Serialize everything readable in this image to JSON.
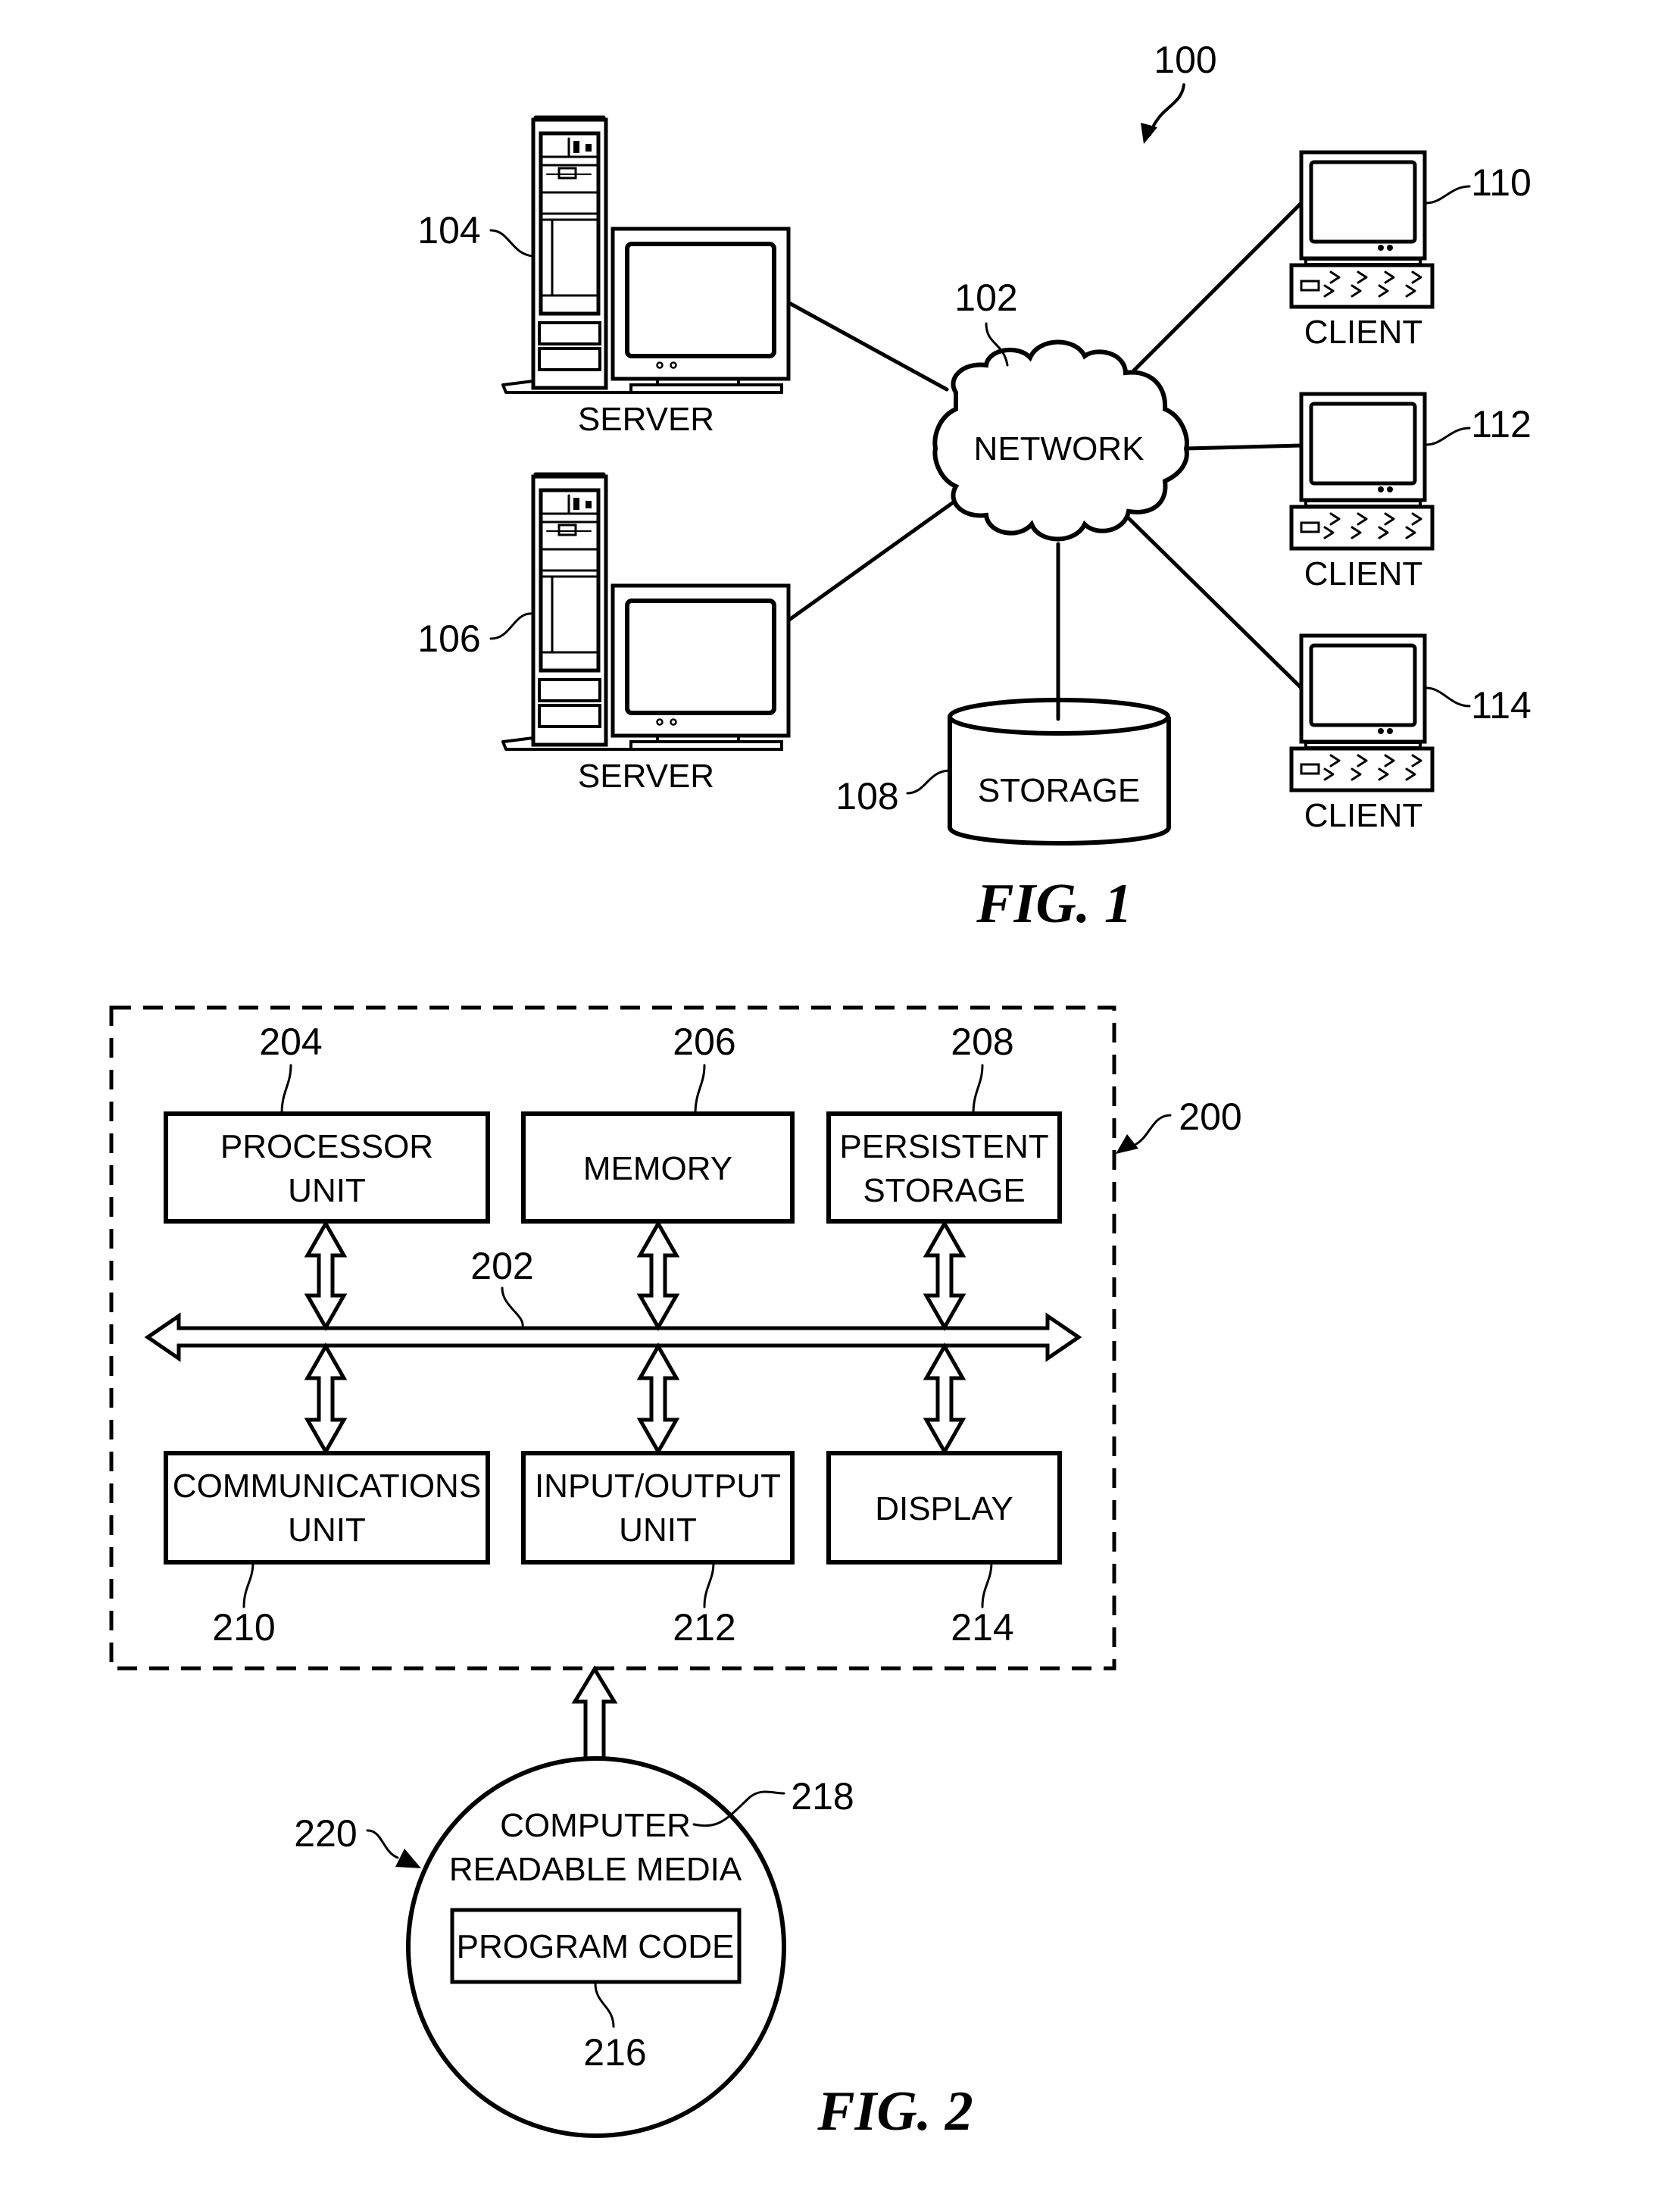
{
  "figure1": {
    "caption": "FIG. 1",
    "system_ref": "100",
    "network": {
      "label": "NETWORK",
      "ref": "102"
    },
    "servers": [
      {
        "label": "SERVER",
        "ref": "104"
      },
      {
        "label": "SERVER",
        "ref": "106"
      }
    ],
    "storage": {
      "label": "STORAGE",
      "ref": "108"
    },
    "clients": [
      {
        "label": "CLIENT",
        "ref": "110"
      },
      {
        "label": "CLIENT",
        "ref": "112"
      },
      {
        "label": "CLIENT",
        "ref": "114"
      }
    ]
  },
  "figure2": {
    "caption": "FIG. 2",
    "system_ref": "200",
    "bus_ref": "202",
    "top_row": [
      {
        "line1": "PROCESSOR",
        "line2": "UNIT",
        "ref": "204"
      },
      {
        "line1": "MEMORY",
        "line2": "",
        "ref": "206"
      },
      {
        "line1": "PERSISTENT",
        "line2": "STORAGE",
        "ref": "208"
      }
    ],
    "bottom_row": [
      {
        "line1": "COMMUNICATIONS",
        "line2": "UNIT",
        "ref": "210"
      },
      {
        "line1": "INPUT/OUTPUT",
        "line2": "UNIT",
        "ref": "212"
      },
      {
        "line1": "DISPLAY",
        "line2": "",
        "ref": "214"
      }
    ],
    "media": {
      "line1": "COMPUTER",
      "line2": "READABLE MEDIA",
      "ref": "218",
      "product_ref": "220",
      "program_code": {
        "label": "PROGRAM CODE",
        "ref": "216"
      }
    }
  }
}
